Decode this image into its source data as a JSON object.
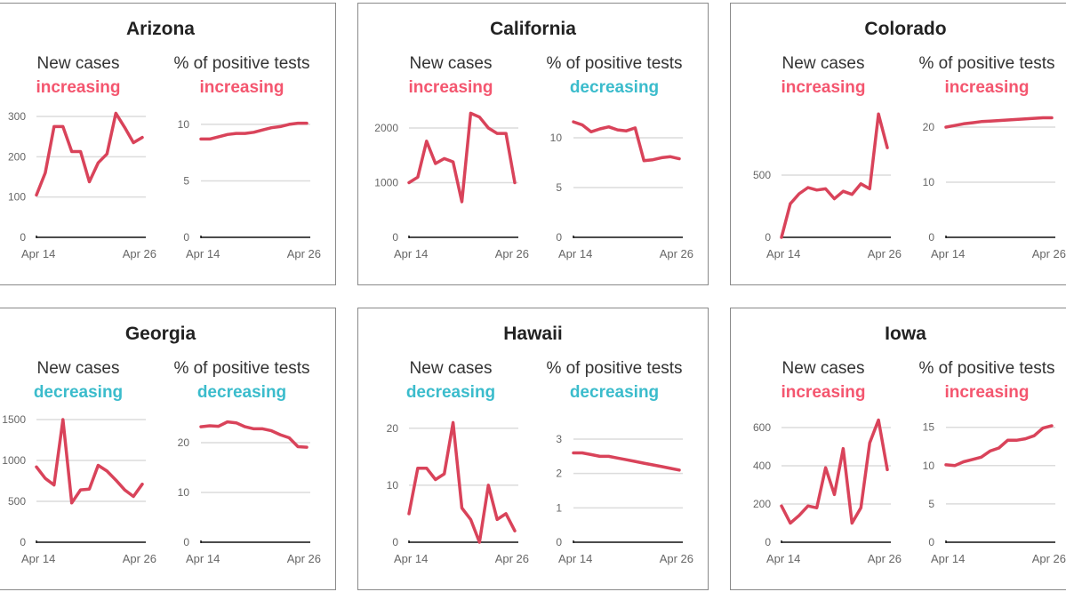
{
  "colors": {
    "increasing": "#f4566f",
    "decreasing": "#3bbccc",
    "line": "#d9435a"
  },
  "labels": {
    "cases": "New cases",
    "positive": "% of positive tests",
    "increasing": "increasing",
    "decreasing": "decreasing"
  },
  "chart_data": [
    {
      "state": "Arizona",
      "charts": [
        {
          "type": "line",
          "title": "New cases",
          "trend": "increasing",
          "x": [
            "Apr 14",
            "Apr 15",
            "Apr 16",
            "Apr 17",
            "Apr 18",
            "Apr 19",
            "Apr 20",
            "Apr 21",
            "Apr 22",
            "Apr 23",
            "Apr 24",
            "Apr 25",
            "Apr 26"
          ],
          "xticks": [
            "Apr 14",
            "Apr 26"
          ],
          "yticks": [
            0,
            100,
            200,
            300
          ],
          "ylim": [
            0,
            331
          ],
          "values": [
            105,
            160,
            275,
            275,
            213,
            213,
            138,
            185,
            207,
            308,
            273,
            235,
            248
          ]
        },
        {
          "type": "line",
          "title": "% of positive tests",
          "trend": "increasing",
          "x": [
            "Apr 14",
            "Apr 15",
            "Apr 16",
            "Apr 17",
            "Apr 18",
            "Apr 19",
            "Apr 20",
            "Apr 21",
            "Apr 22",
            "Apr 23",
            "Apr 24",
            "Apr 25",
            "Apr 26"
          ],
          "xticks": [
            "Apr 14",
            "Apr 26"
          ],
          "yticks": [
            0,
            5,
            10
          ],
          "ylim": [
            0,
            11.8
          ],
          "values": [
            8.7,
            8.7,
            8.9,
            9.1,
            9.2,
            9.2,
            9.3,
            9.5,
            9.7,
            9.8,
            10.0,
            10.1,
            10.1
          ]
        }
      ]
    },
    {
      "state": "California",
      "charts": [
        {
          "type": "line",
          "title": "New cases",
          "trend": "increasing",
          "x": [
            "Apr 14",
            "Apr 15",
            "Apr 16",
            "Apr 17",
            "Apr 18",
            "Apr 19",
            "Apr 20",
            "Apr 21",
            "Apr 22",
            "Apr 23",
            "Apr 24",
            "Apr 25",
            "Apr 26"
          ],
          "xticks": [
            "Apr 14",
            "Apr 26"
          ],
          "yticks": [
            0,
            1000,
            2000
          ],
          "ylim": [
            0,
            2439
          ],
          "values": [
            1000,
            1100,
            1760,
            1350,
            1440,
            1380,
            650,
            2270,
            2200,
            2000,
            1900,
            1900,
            1000
          ]
        },
        {
          "type": "line",
          "title": "% of positive tests",
          "trend": "decreasing",
          "x": [
            "Apr 14",
            "Apr 15",
            "Apr 16",
            "Apr 17",
            "Apr 18",
            "Apr 19",
            "Apr 20",
            "Apr 21",
            "Apr 22",
            "Apr 23",
            "Apr 24",
            "Apr 25",
            "Apr 26"
          ],
          "xticks": [
            "Apr 14",
            "Apr 26"
          ],
          "yticks": [
            0,
            5,
            10
          ],
          "ylim": [
            0,
            13.4
          ],
          "values": [
            11.6,
            11.3,
            10.6,
            10.9,
            11.1,
            10.8,
            10.7,
            11.0,
            7.7,
            7.8,
            8.0,
            8.1,
            7.9
          ]
        }
      ]
    },
    {
      "state": "Colorado",
      "charts": [
        {
          "type": "line",
          "title": "New cases",
          "trend": "increasing",
          "x": [
            "Apr 14",
            "Apr 15",
            "Apr 16",
            "Apr 17",
            "Apr 18",
            "Apr 19",
            "Apr 20",
            "Apr 21",
            "Apr 22",
            "Apr 23",
            "Apr 24",
            "Apr 25",
            "Apr 26"
          ],
          "xticks": [
            "Apr 14",
            "Apr 26"
          ],
          "yticks": [
            0,
            500
          ],
          "ylim": [
            0,
            1071
          ],
          "values": [
            0,
            270,
            350,
            400,
            380,
            390,
            310,
            370,
            345,
            430,
            390,
            990,
            720
          ]
        },
        {
          "type": "line",
          "title": "% of positive tests",
          "trend": "increasing",
          "x": [
            "Apr 14",
            "Apr 15",
            "Apr 16",
            "Apr 17",
            "Apr 18",
            "Apr 19",
            "Apr 20",
            "Apr 21",
            "Apr 22",
            "Apr 23",
            "Apr 24",
            "Apr 25",
            "Apr 26"
          ],
          "xticks": [
            "Apr 14",
            "Apr 26"
          ],
          "yticks": [
            0,
            10,
            20
          ],
          "ylim": [
            0,
            24.2
          ],
          "values": [
            20.0,
            20.3,
            20.6,
            20.8,
            21.0,
            21.1,
            21.2,
            21.3,
            21.4,
            21.5,
            21.6,
            21.7,
            21.7
          ]
        }
      ]
    },
    {
      "state": "Georgia",
      "charts": [
        {
          "type": "line",
          "title": "New cases",
          "trend": "decreasing",
          "x": [
            "Apr 14",
            "Apr 15",
            "Apr 16",
            "Apr 17",
            "Apr 18",
            "Apr 19",
            "Apr 20",
            "Apr 21",
            "Apr 22",
            "Apr 23",
            "Apr 24",
            "Apr 25",
            "Apr 26"
          ],
          "xticks": [
            "Apr 14",
            "Apr 26"
          ],
          "yticks": [
            0,
            500,
            1000,
            1500
          ],
          "ylim": [
            0,
            1630
          ],
          "values": [
            920,
            780,
            700,
            1500,
            480,
            640,
            650,
            940,
            870,
            760,
            640,
            560,
            710
          ]
        },
        {
          "type": "line",
          "title": "% of positive tests",
          "trend": "decreasing",
          "x": [
            "Apr 14",
            "Apr 15",
            "Apr 16",
            "Apr 17",
            "Apr 18",
            "Apr 19",
            "Apr 20",
            "Apr 21",
            "Apr 22",
            "Apr 23",
            "Apr 24",
            "Apr 25",
            "Apr 26"
          ],
          "xticks": [
            "Apr 14",
            "Apr 26"
          ],
          "yticks": [
            0,
            10,
            20
          ],
          "ylim": [
            0,
            26.8
          ],
          "values": [
            23.2,
            23.4,
            23.3,
            24.2,
            24.0,
            23.2,
            22.8,
            22.8,
            22.4,
            21.6,
            21.0,
            19.2,
            19.1
          ]
        }
      ]
    },
    {
      "state": "Hawaii",
      "charts": [
        {
          "type": "line",
          "title": "New cases",
          "trend": "decreasing",
          "x": [
            "Apr 14",
            "Apr 15",
            "Apr 16",
            "Apr 17",
            "Apr 18",
            "Apr 19",
            "Apr 20",
            "Apr 21",
            "Apr 22",
            "Apr 23",
            "Apr 24",
            "Apr 25",
            "Apr 26"
          ],
          "xticks": [
            "Apr 14",
            "Apr 26"
          ],
          "yticks": [
            0,
            10,
            20
          ],
          "ylim": [
            0,
            23.4
          ],
          "values": [
            5,
            13,
            13,
            11,
            12,
            21,
            6,
            4,
            0,
            10,
            4,
            5,
            2
          ]
        },
        {
          "type": "line",
          "title": "% of positive tests",
          "trend": "decreasing",
          "x": [
            "Apr 14",
            "Apr 15",
            "Apr 16",
            "Apr 17",
            "Apr 18",
            "Apr 19",
            "Apr 20",
            "Apr 21",
            "Apr 22",
            "Apr 23",
            "Apr 24",
            "Apr 25",
            "Apr 26"
          ],
          "xticks": [
            "Apr 14",
            "Apr 26"
          ],
          "yticks": [
            0,
            1,
            2,
            3
          ],
          "ylim": [
            0,
            3.88
          ],
          "values": [
            2.6,
            2.6,
            2.55,
            2.5,
            2.5,
            2.45,
            2.4,
            2.35,
            2.3,
            2.25,
            2.2,
            2.15,
            2.1
          ]
        }
      ]
    },
    {
      "state": "Iowa",
      "charts": [
        {
          "type": "line",
          "title": "New cases",
          "trend": "increasing",
          "x": [
            "Apr 14",
            "Apr 15",
            "Apr 16",
            "Apr 17",
            "Apr 18",
            "Apr 19",
            "Apr 20",
            "Apr 21",
            "Apr 22",
            "Apr 23",
            "Apr 24",
            "Apr 25",
            "Apr 26"
          ],
          "xticks": [
            "Apr 14",
            "Apr 26"
          ],
          "yticks": [
            0,
            200,
            400,
            600
          ],
          "ylim": [
            0,
            698
          ],
          "values": [
            190,
            100,
            140,
            190,
            180,
            390,
            250,
            490,
            100,
            180,
            520,
            640,
            380
          ]
        },
        {
          "type": "line",
          "title": "% of positive tests",
          "trend": "increasing",
          "x": [
            "Apr 14",
            "Apr 15",
            "Apr 16",
            "Apr 17",
            "Apr 18",
            "Apr 19",
            "Apr 20",
            "Apr 21",
            "Apr 22",
            "Apr 23",
            "Apr 24",
            "Apr 25",
            "Apr 26"
          ],
          "xticks": [
            "Apr 14",
            "Apr 26"
          ],
          "yticks": [
            0,
            5,
            10,
            15
          ],
          "ylim": [
            0,
            17.4
          ],
          "values": [
            10.1,
            10.0,
            10.5,
            10.8,
            11.1,
            11.9,
            12.3,
            13.3,
            13.3,
            13.5,
            13.9,
            14.9,
            15.2
          ]
        }
      ]
    }
  ]
}
